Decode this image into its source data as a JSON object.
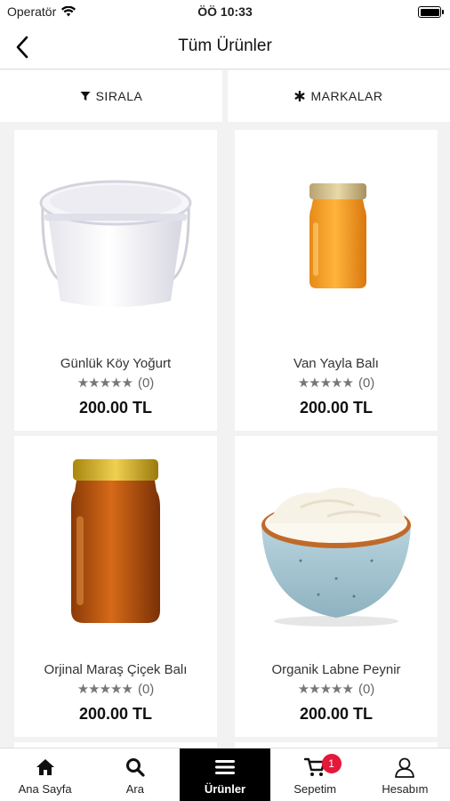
{
  "status_bar": {
    "carrier": "Operatör",
    "time": "ÖÖ 10:33"
  },
  "header": {
    "title": "Tüm Ürünler"
  },
  "filters": {
    "sort_label": "SIRALA",
    "brands_label": "MARKALAR"
  },
  "products": [
    {
      "name": "Günlük Köy Yoğurt",
      "rating_count": "(0)",
      "price": "200.00 TL",
      "image": "yogurt-bucket"
    },
    {
      "name": "Van Yayla Balı",
      "rating_count": "(0)",
      "price": "200.00 TL",
      "image": "honey-jar-small"
    },
    {
      "name": "Orjinal Maraş Çiçek Balı",
      "rating_count": "(0)",
      "price": "200.00 TL",
      "image": "honey-jar-large"
    },
    {
      "name": "Organik Labne Peynir",
      "rating_count": "(0)",
      "price": "200.00 TL",
      "image": "labneh-bowl"
    }
  ],
  "tabs": [
    {
      "label": "Ana Sayfa",
      "icon": "home-icon"
    },
    {
      "label": "Ara",
      "icon": "search-icon"
    },
    {
      "label": "Ürünler",
      "icon": "menu-icon",
      "active": true
    },
    {
      "label": "Sepetim",
      "icon": "cart-icon",
      "badge": "1"
    },
    {
      "label": "Hesabım",
      "icon": "user-icon"
    }
  ],
  "colors": {
    "accent": "#000000",
    "badge": "#e5173a",
    "background": "#f2f2f2"
  }
}
